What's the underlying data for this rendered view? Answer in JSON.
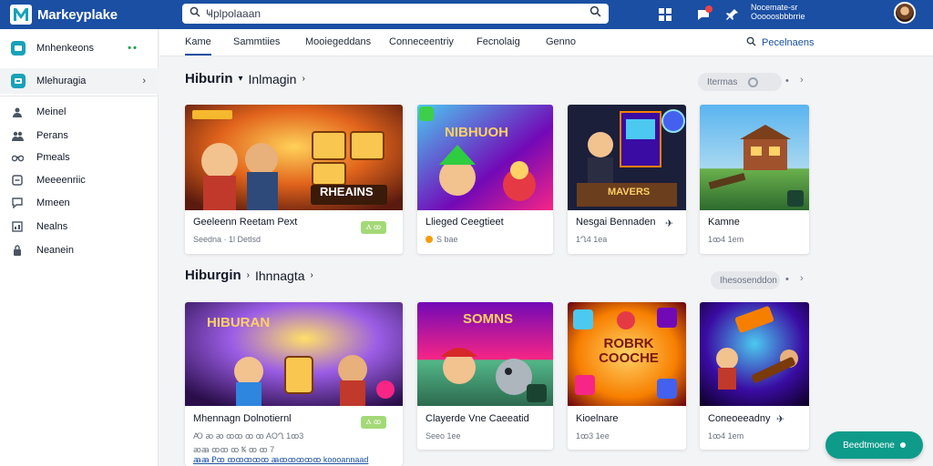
{
  "app": {
    "title": "Markeyplake"
  },
  "search": {
    "placeholder": "",
    "value": "Ҹрlpolaaan"
  },
  "top_status": {
    "line1": "Nocemate-sr",
    "line2": "Ooooosbbbrrie"
  },
  "sidebar": {
    "primary": [
      {
        "label": "Mnhenkeons",
        "icon": "storefront-icon"
      },
      {
        "label": "Mlehuragia",
        "icon": "game-icon"
      }
    ],
    "links": [
      {
        "label": "Meinel",
        "icon": "person-icon"
      },
      {
        "label": "Perans",
        "icon": "people-icon"
      },
      {
        "label": "Pmeals",
        "icon": "binoculars-icon"
      },
      {
        "label": "Meeeenriic",
        "icon": "message-icon"
      },
      {
        "label": "Mmeen",
        "icon": "chat-icon"
      },
      {
        "label": "Nealns",
        "icon": "chart-icon"
      },
      {
        "label": "Neanein",
        "icon": "lock-icon"
      }
    ]
  },
  "tabs": [
    "Kame",
    "Sammtiies",
    "Mooiegeddans",
    "Conneceentriy",
    "Fecnolaig",
    "Genno"
  ],
  "subnav_right": "Pecelnaens",
  "sections": [
    {
      "main": "Hiburin",
      "sub": "Inlmagin",
      "pill": "Itermas",
      "cards": [
        {
          "title": "Geeleenn Reetam Pext",
          "meta": "Seedna  ·  1l Detlsd",
          "badge": "Ⲁ ꝏ",
          "art": "art-1",
          "overlay": "RHEAINS"
        },
        {
          "title": "Llieged Ceegtieet",
          "meta": "S bae",
          "art": "art-2",
          "overlay": "NIBHUOH"
        },
        {
          "title": "Nesgai Bennaden",
          "meta": "1Ղ4 1ea",
          "art": "art-3",
          "overlay": "MAVERS"
        },
        {
          "title": "Kamne",
          "meta": "1ꝏ4 1em",
          "art": "art-4"
        }
      ]
    },
    {
      "main": "Hiburgin",
      "sub": "Ihnnagta",
      "pill": "Ihesosenddon",
      "cards": [
        {
          "title": "Mhennagn Dolnotiernl",
          "meta": "Ꜵ ꜵ ꜵ ꝏꝏ  ꝏ ꝏ  AOՂ 1ꝏ3",
          "meta2": "ꜵꜳ ꝏꝏ ꝏ  Ꝅ ꝏ ꝏ 7",
          "meta3": "ꜳꜳ Ꝑꝏ ꝏꝏꝏꝏꝏ  ꜳꝏꝏꝏꝏꝏ koooannaad",
          "badge": "Ⲁ ꝏ",
          "art": "art-5",
          "overlay": "HIBURAN"
        },
        {
          "title": "Clayerde Vne Caeeatid",
          "meta": "Seeo 1ee",
          "art": "art-6",
          "overlay": "SOMNS"
        },
        {
          "title": "Kioelnare",
          "meta": "1ꝏ3 1ee",
          "art": "art-7",
          "overlay": "ROBRK COOCHE"
        },
        {
          "title": "Coneoeeadny",
          "meta": "1ꝏ4 1em",
          "art": "art-8"
        }
      ]
    }
  ],
  "fab": {
    "label": "Beedtmoene"
  },
  "colors": {
    "brand": "#1a4fa3",
    "accent": "#0e9b8a",
    "badge": "#a3d977"
  }
}
